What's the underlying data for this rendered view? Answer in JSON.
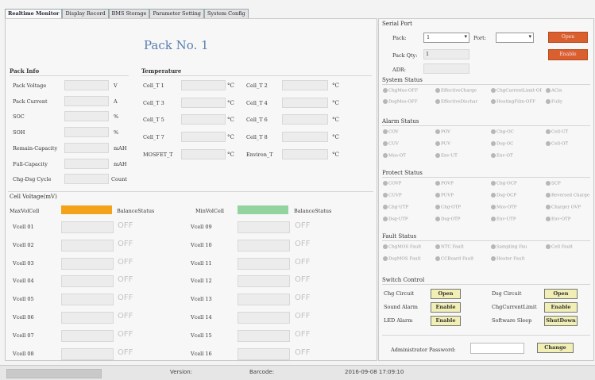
{
  "tabs": [
    "Realtime Monitor",
    "Display Record",
    "BMS Storage",
    "Parameter Setting",
    "System Config"
  ],
  "pack_title": "Pack No. 1",
  "pack_info": {
    "title": "Pack Info",
    "rows": [
      {
        "label": "Pack Voltage",
        "unit": "V"
      },
      {
        "label": "Pack Current",
        "unit": "A"
      },
      {
        "label": "SOC",
        "unit": "%"
      },
      {
        "label": "SOH",
        "unit": "%"
      },
      {
        "label": "Remain-Capacity",
        "unit": "mAH"
      },
      {
        "label": "Full-Capacity",
        "unit": "mAH"
      },
      {
        "label": "Chg-Dsg Cycle",
        "unit": "Count"
      }
    ]
  },
  "temperature": {
    "title": "Temperature",
    "unit": "°C",
    "left": [
      "Cell_T 1",
      "Cell_T 3",
      "Cell_T 5",
      "Cell_T 7",
      "MOSFET_T"
    ],
    "right": [
      "Cell_T 2",
      "Cell_T 4",
      "Cell_T 6",
      "Cell_T 8",
      "Environ_T"
    ]
  },
  "cell_voltage": {
    "title": "Cell Voltage(mV)",
    "max_label": "MaxVolCell",
    "min_label": "MinVolCell",
    "balance_label": "BalanceStatus",
    "max_color": "#f2a31b",
    "min_color": "#92d3a0",
    "left": [
      "Vcell 01",
      "Vcell 02",
      "Vcell 03",
      "Vcell 04",
      "Vcell 05",
      "Vcell 06",
      "Vcell 07",
      "Vcell 08"
    ],
    "right": [
      "Vcell 09",
      "Vcell 10",
      "Vcell 11",
      "Vcell 12",
      "Vcell 13",
      "Vcell 14",
      "Vcell 15",
      "Vcell 16"
    ],
    "off_label": "OFF"
  },
  "serial": {
    "title": "Serial Port",
    "pack_label": "Pack:",
    "pack_value": "1",
    "port_label": "Port:",
    "pack_qty_label": "Pack Qty:",
    "pack_qty_value": "1",
    "addr_label": "ADR:",
    "open_label": "Open",
    "enable_label": "Enable"
  },
  "system_status": {
    "title": "System Status",
    "items": [
      "ChgMos-OFF",
      "EffectiveCharge",
      "ChgCurrentLimit-OFF",
      "ACin",
      "DsgMos-OFF",
      "EffectiveDischar",
      "HeatingFilm-OFF",
      "Fully"
    ]
  },
  "alarm_status": {
    "title": "Alarm Status",
    "items": [
      "COV",
      "POV",
      "Chg-OC",
      "Cell-UT",
      "CUV",
      "PUV",
      "Dsg-OC",
      "Cell-OT",
      "Mos-OT",
      "Env-UT",
      "Env-OT"
    ]
  },
  "protect_status": {
    "title": "Protect Status",
    "items": [
      "COVP",
      "POVP",
      "Chg-OCP",
      "SCP",
      "CUVP",
      "PUVP",
      "Dsg-OCP",
      "Reversed Charge",
      "Chg-UTP",
      "Chg-OTP",
      "Mos-OTP",
      "Charger OVP",
      "Dsg-UTP",
      "Dsg-OTP",
      "Env-UTP",
      "Env-OTP"
    ]
  },
  "fault_status": {
    "title": "Fault Status",
    "items": [
      "ChgMOS Fault",
      "NTC Fault",
      "Sampling Fau",
      "Cell Fault",
      "DsgMOS Fault",
      "CCBoard Fault",
      "Heater Fault"
    ]
  },
  "switch_control": {
    "title": "Switch Control",
    "rows": [
      {
        "l_label": "Chg Circuit",
        "l_btn": "Open",
        "r_label": "Dsg Circuit",
        "r_btn": "Open"
      },
      {
        "l_label": "Sound Alarm",
        "l_btn": "Enable",
        "r_label": "ChgCurrentLimit",
        "r_btn": "Enable"
      },
      {
        "l_label": "LED Alarm",
        "l_btn": "Enable",
        "r_label": "Software Sleep",
        "r_btn": "ShutDown"
      }
    ]
  },
  "admin": {
    "label": "Administrator Password:",
    "change_label": "Change"
  },
  "statusbar": {
    "version_label": "Version:",
    "barcode_label": "Barcode:",
    "datetime": "2016-09-08 17:09:10"
  }
}
